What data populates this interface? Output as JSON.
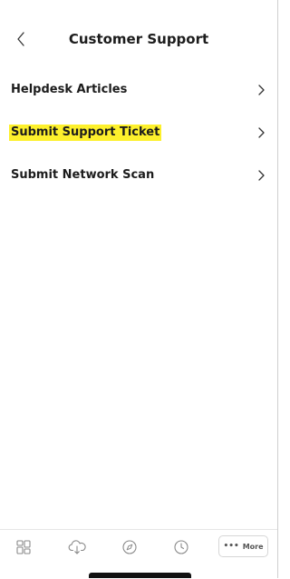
{
  "header": {
    "title": "Customer Support",
    "back_icon": "chevron-left-icon"
  },
  "menu": {
    "items": [
      {
        "label": "Helpdesk Articles",
        "highlighted": false
      },
      {
        "label": "Submit Support Ticket",
        "highlighted": true
      },
      {
        "label": "Submit Network Scan",
        "highlighted": false
      }
    ]
  },
  "tabbar": {
    "tabs": [
      {
        "icon": "dashboard-grid-icon"
      },
      {
        "icon": "cloud-download-icon"
      },
      {
        "icon": "compass-icon"
      },
      {
        "icon": "history-clock-icon"
      }
    ],
    "more_label": "More"
  },
  "colors": {
    "highlight": "#fdf02c",
    "text": "#1c1c1c",
    "icon": "#8a8a8a"
  }
}
